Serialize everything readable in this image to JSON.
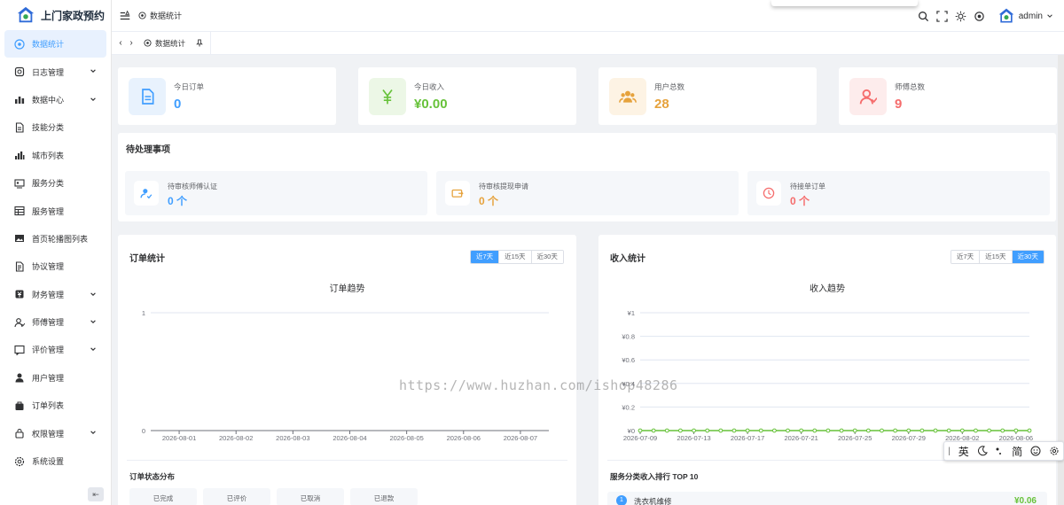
{
  "app": {
    "title": "上门家政预约"
  },
  "sidebar": {
    "items": [
      {
        "label": "数据统计",
        "icon": "dashboard-icon",
        "active": true,
        "expandable": false
      },
      {
        "label": "日志管理",
        "icon": "log-icon",
        "expandable": true
      },
      {
        "label": "数据中心",
        "icon": "bar-chart-icon",
        "expandable": true
      },
      {
        "label": "技能分类",
        "icon": "document-icon",
        "expandable": false
      },
      {
        "label": "城市列表",
        "icon": "city-chart-icon",
        "expandable": false
      },
      {
        "label": "服务分类",
        "icon": "service-category-icon",
        "expandable": false
      },
      {
        "label": "服务管理",
        "icon": "table-icon",
        "expandable": false
      },
      {
        "label": "首页轮播图列表",
        "icon": "image-icon",
        "expandable": false
      },
      {
        "label": "协议管理",
        "icon": "agreement-icon",
        "expandable": false
      },
      {
        "label": "财务管理",
        "icon": "finance-icon",
        "expandable": true
      },
      {
        "label": "师傅管理",
        "icon": "worker-icon",
        "expandable": true
      },
      {
        "label": "评价管理",
        "icon": "review-icon",
        "expandable": true
      },
      {
        "label": "用户管理",
        "icon": "user-icon",
        "expandable": false
      },
      {
        "label": "订单列表",
        "icon": "bag-icon",
        "expandable": false
      },
      {
        "label": "权限管理",
        "icon": "lock-icon",
        "expandable": true
      },
      {
        "label": "系统设置",
        "icon": "gear-icon",
        "expandable": false
      }
    ],
    "collapse_glyph": "⇤"
  },
  "header": {
    "breadcrumb": "数据统计",
    "user": "admin"
  },
  "tags": {
    "active_tab": "数据统计"
  },
  "stats": [
    {
      "label": "今日订单",
      "value": "0",
      "icon": "order-doc-icon",
      "color": "#409eff",
      "bg": "#e8f2fd"
    },
    {
      "label": "今日收入",
      "value": "¥0.00",
      "icon": "yen-icon",
      "color": "#67c23a",
      "bg": "#ecf7e6"
    },
    {
      "label": "用户总数",
      "value": "28",
      "icon": "users-icon",
      "color": "#e6a23c",
      "bg": "#fdf3e4"
    },
    {
      "label": "师傅总数",
      "value": "9",
      "icon": "worker-icon",
      "color": "#f56c6c",
      "bg": "#fdecec"
    }
  ],
  "pending": {
    "title": "待处理事项",
    "items": [
      {
        "label": "待审核师傅认证",
        "value": "0 个",
        "icon": "verify-user-icon",
        "color": "#409eff"
      },
      {
        "label": "待审核提现申请",
        "value": "0 个",
        "icon": "withdraw-icon",
        "color": "#e6a23c"
      },
      {
        "label": "待接单订单",
        "value": "0 个",
        "icon": "clock-icon",
        "color": "#f56c6c"
      }
    ]
  },
  "orders_panel": {
    "title": "订单统计",
    "ranges": [
      "近7天",
      "近15天",
      "近30天"
    ],
    "active_range": "近7天",
    "status_title": "订单状态分布",
    "statuses": [
      "已完成",
      "已评价",
      "已取消",
      "已退款"
    ]
  },
  "income_panel": {
    "title": "收入统计",
    "ranges": [
      "近7天",
      "近15天",
      "近30天"
    ],
    "active_range": "近30天",
    "ranking_title": "服务分类收入排行 TOP 10",
    "ranking": [
      {
        "rank": "1",
        "name": "洗衣机维修",
        "amount": "¥0.06"
      }
    ]
  },
  "chart_data": [
    {
      "type": "line",
      "title": "订单趋势",
      "categories": [
        "2026-08-01",
        "2026-08-02",
        "2026-08-03",
        "2026-08-04",
        "2026-08-05",
        "2026-08-06",
        "2026-08-07"
      ],
      "series": [
        {
          "values": [
            0,
            0,
            0,
            0,
            0,
            0,
            0
          ]
        }
      ],
      "ylim": [
        0,
        1
      ],
      "yticks": [
        "0",
        "1"
      ],
      "grid": true
    },
    {
      "type": "line",
      "title": "收入趋势",
      "categories": [
        "2026-07-09",
        "2026-07-10",
        "2026-07-11",
        "2026-07-12",
        "2026-07-13",
        "2026-07-14",
        "2026-07-15",
        "2026-07-16",
        "2026-07-17",
        "2026-07-18",
        "2026-07-19",
        "2026-07-20",
        "2026-07-21",
        "2026-07-22",
        "2026-07-23",
        "2026-07-24",
        "2026-07-25",
        "2026-07-26",
        "2026-07-27",
        "2026-07-28",
        "2026-07-29",
        "2026-07-30",
        "2026-07-31",
        "2026-08-01",
        "2026-08-02",
        "2026-08-03",
        "2026-08-04",
        "2026-08-05",
        "2026-08-06",
        "2026-08-07"
      ],
      "xticks": [
        "2026-07-09",
        "2026-07-13",
        "2026-07-17",
        "2026-07-21",
        "2026-07-25",
        "2026-07-29",
        "2026-08-02",
        "2026-08-06"
      ],
      "series": [
        {
          "values": [
            0,
            0,
            0,
            0,
            0,
            0,
            0,
            0,
            0,
            0,
            0,
            0,
            0,
            0,
            0,
            0,
            0,
            0,
            0,
            0,
            0,
            0,
            0,
            0,
            0,
            0,
            0,
            0,
            0,
            0
          ],
          "color": "#67c23a"
        }
      ],
      "ylim": [
        0,
        1
      ],
      "yticks": [
        "¥0",
        "¥0.2",
        "¥0.4",
        "¥0.6",
        "¥0.8",
        "¥1"
      ],
      "grid": true
    }
  ],
  "watermark": "https://www.huzhan.com/ishop48286",
  "ime": {
    "items": [
      "英",
      "简"
    ]
  }
}
